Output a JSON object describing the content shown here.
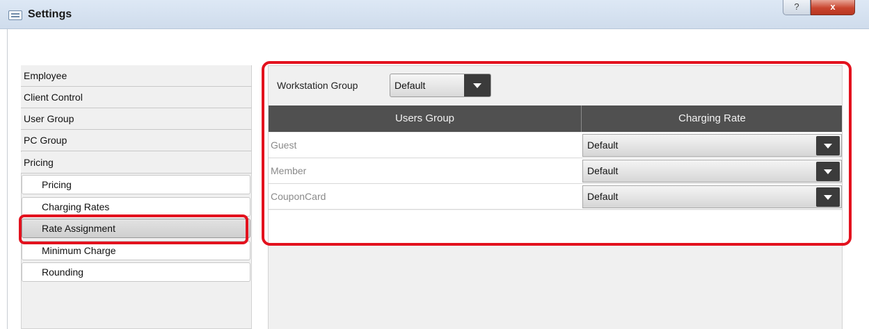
{
  "window": {
    "title": "Settings",
    "help_label": "?",
    "close_label": "x"
  },
  "sidebar": {
    "items": [
      {
        "label": "Employee"
      },
      {
        "label": "Client Control"
      },
      {
        "label": "User Group"
      },
      {
        "label": "PC Group"
      },
      {
        "label": "Pricing"
      }
    ],
    "sub_items": [
      {
        "label": "Pricing"
      },
      {
        "label": "Charging Rates"
      },
      {
        "label": "Rate Assignment"
      },
      {
        "label": "Minimum Charge"
      },
      {
        "label": "Rounding"
      }
    ],
    "selected": "Rate Assignment"
  },
  "workstation": {
    "label": "Workstation Group",
    "value": "Default"
  },
  "grid": {
    "headers": [
      "Users Group",
      "Charging Rate"
    ],
    "rows": [
      {
        "group": "Guest",
        "rate": "Default"
      },
      {
        "group": "Member",
        "rate": "Default"
      },
      {
        "group": "CouponCard",
        "rate": "Default"
      }
    ]
  },
  "colors": {
    "highlight": "#e3121e",
    "grid_header": "#505050",
    "dropdown_button": "#3b3b3b"
  },
  "icons": {
    "app": "settings-window-icon",
    "dropdown": "chevron-down-icon"
  }
}
